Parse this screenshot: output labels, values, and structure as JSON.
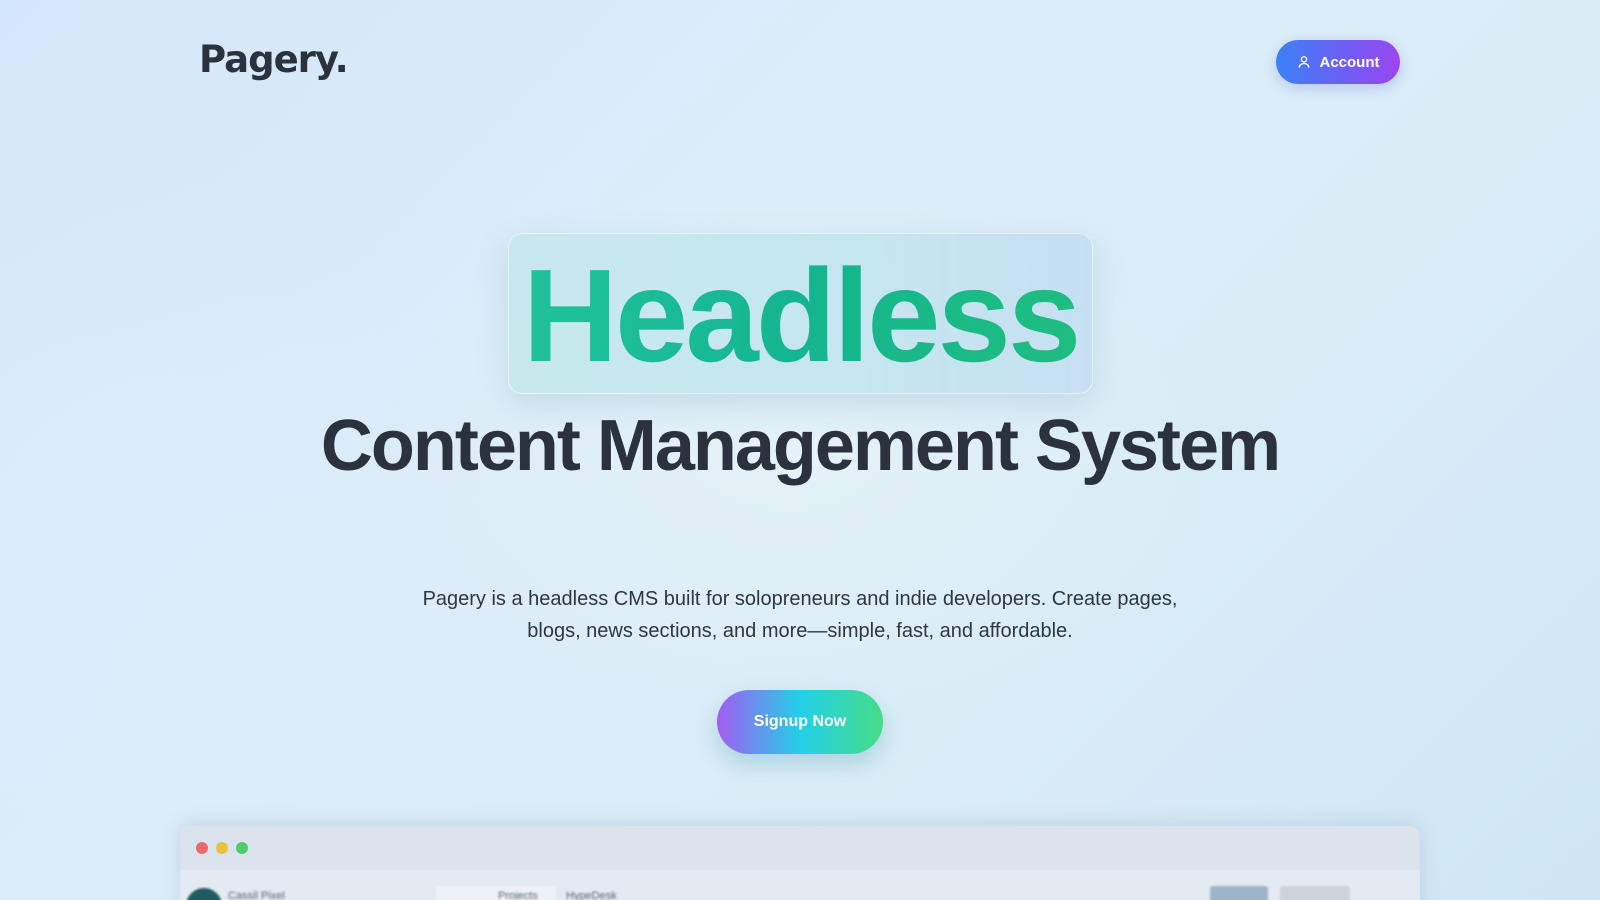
{
  "header": {
    "logo_text": "Pagery.",
    "account_button_label": "Account",
    "account_icon": "user-icon"
  },
  "hero": {
    "badge_text": "Headless",
    "title": "Content Management System",
    "subtitle": "Pagery is a headless CMS built for solopreneurs and indie developers. Create pages, blogs, news sections, and more—simple, fast, and affordable.",
    "cta_label": "Signup Now"
  },
  "preview": {
    "window_controls": [
      "close",
      "minimize",
      "maximize"
    ],
    "nav_items": [
      "Cassil Pixel",
      "Projects",
      "HypeDesk"
    ]
  },
  "colors": {
    "accent_green": "#1fbd91",
    "account_gradient_start": "#3b82f6",
    "account_gradient_end": "#9b45f0",
    "text_dark": "#2b323d"
  }
}
